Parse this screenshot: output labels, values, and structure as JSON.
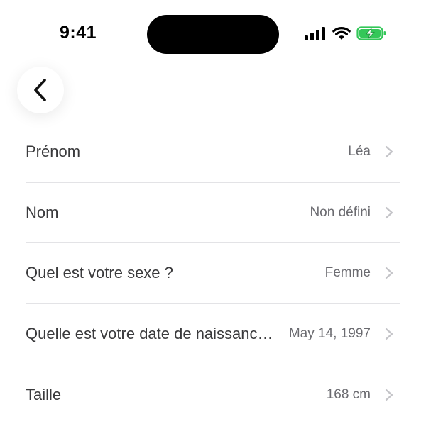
{
  "status_bar": {
    "time": "9:41",
    "battery_color": "#34c759"
  },
  "nav": {
    "back_icon": "chevron-left-icon"
  },
  "fields": [
    {
      "label": "Prénom",
      "value": "Léa"
    },
    {
      "label": "Nom",
      "value": "Non défini"
    },
    {
      "label": "Quel est votre sexe ?",
      "value": "Femme"
    },
    {
      "label": "Quelle est votre date de naissance ?",
      "value": "May 14, 1997"
    },
    {
      "label": "Taille",
      "value": "168 cm"
    }
  ],
  "colors": {
    "label": "#3a3a3c",
    "value": "#6b6b70",
    "divider": "#e3e3e6",
    "chevron": "#c4c4c8"
  }
}
